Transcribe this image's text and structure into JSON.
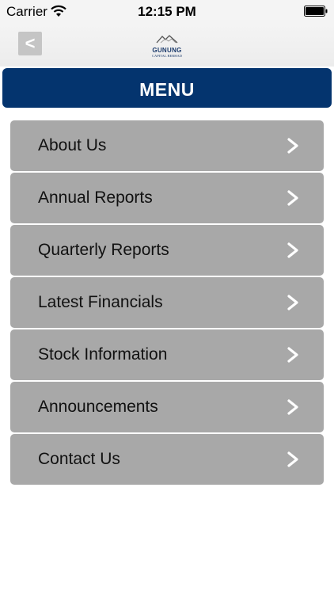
{
  "status_bar": {
    "carrier": "Carrier",
    "time": "12:15 PM"
  },
  "nav_bar": {
    "back_label": "<",
    "logo_name": "GUNUNG",
    "logo_subtitle": "CAPITAL BERHAD"
  },
  "menu": {
    "title": "MENU",
    "items": [
      {
        "label": "About Us"
      },
      {
        "label": "Annual Reports"
      },
      {
        "label": "Quarterly Reports"
      },
      {
        "label": "Latest Financials"
      },
      {
        "label": "Stock Information"
      },
      {
        "label": "Announcements"
      },
      {
        "label": "Contact Us"
      }
    ]
  },
  "colors": {
    "header_bg": "#04346e",
    "item_bg": "#a8a8a8",
    "chevron": "#ffffff"
  },
  "icons": {
    "wifi": "wifi-icon",
    "battery": "battery-icon",
    "back": "chevron-left-icon",
    "item_arrow": "chevron-right-icon",
    "logo": "mountain-logo-icon"
  }
}
